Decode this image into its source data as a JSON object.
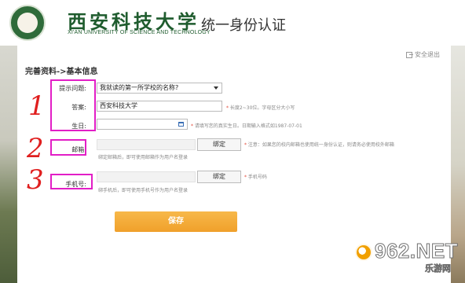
{
  "header": {
    "school_name_cn": "西安科技大学",
    "school_name_en": "XI'AN UNIVERSITY OF SCIENCE AND TECHNOLOGY",
    "system_title": "统一身份认证"
  },
  "toolbar": {
    "logout_label": "安全退出"
  },
  "form": {
    "section_title": "完善资料->基本信息",
    "question": {
      "label": "提示问题:",
      "selected": "我就读的第一所学校的名称?"
    },
    "answer": {
      "label": "答案:",
      "value": "西安科技大学",
      "hint_star": "*",
      "hint": "长度2~30位。字母区分大小写"
    },
    "birthday": {
      "label": "生日:",
      "value": "",
      "hint_star": "*",
      "hint": "请填写您的真实生日。日期输入格式如1987-07-01"
    },
    "email": {
      "label": "邮箱:",
      "value": "",
      "bind_label": "绑定",
      "hint_star": "*",
      "hint": "注意：如果您的校内邮箱也使用统一身份认证，则请务必使用校外邮箱",
      "hint2": "绑定邮箱后，即可使用邮箱作为用户名登录"
    },
    "phone": {
      "label": "手机号:",
      "value": "",
      "bind_label": "绑定",
      "hint_star": "*",
      "hint": "手机号码",
      "hint2": "绑手机后，即可使用手机号作为用户名登录"
    },
    "save_label": "保存"
  },
  "annotations": {
    "n1": "1",
    "n2": "2",
    "n3": "3",
    "color": "#e21ec6",
    "number_color": "#e01f1f"
  },
  "watermark": {
    "main": "962.NET",
    "sub": "乐游网"
  },
  "colors": {
    "brand_green": "#1f5c2e",
    "save_button": "#f0a02a",
    "hint_star": "#e24b3b"
  }
}
